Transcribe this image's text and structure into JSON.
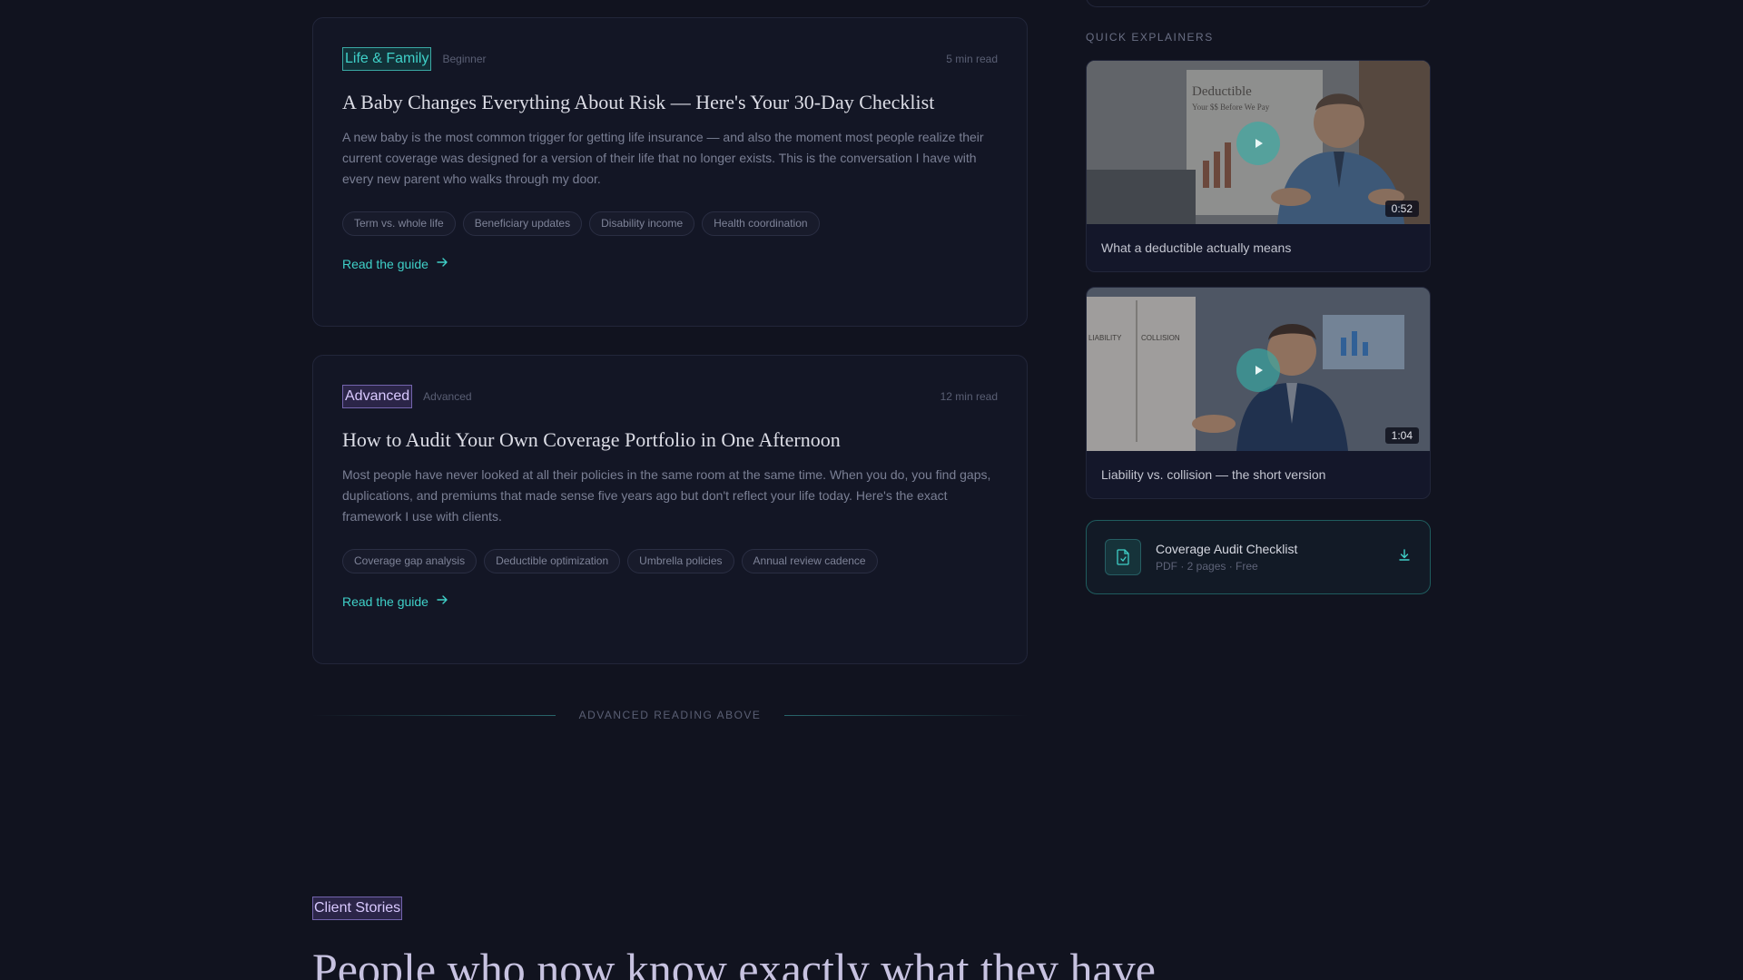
{
  "articles": [
    {
      "category": "Life & Family",
      "level": "Beginner",
      "read_time": "5 min read",
      "title": "A Baby Changes Everything About Risk — Here's Your 30-Day Checklist",
      "description": "A new baby is the most common trigger for getting life insurance — and also the moment most people realize their current coverage was designed for a version of their life that no longer exists. This is the conversation I have with every new parent who walks through my door.",
      "chips": [
        "Term vs. whole life",
        "Beneficiary updates",
        "Disability income",
        "Health coordination"
      ],
      "link": "Read the guide"
    },
    {
      "category": "Advanced",
      "level": "Advanced",
      "read_time": "12 min read",
      "title": "How to Audit Your Own Coverage Portfolio in One Afternoon",
      "description": "Most people have never looked at all their policies in the same room at the same time. When you do, you find gaps, duplications, and premiums that made sense five years ago but don't reflect your life today. Here's the exact framework I use with clients.",
      "chips": [
        "Coverage gap analysis",
        "Deductible optimization",
        "Umbrella policies",
        "Annual review cadence"
      ],
      "link": "Read the guide"
    }
  ],
  "divider_text": "ADVANCED READING ABOVE",
  "client_stories": {
    "tag": "Client Stories",
    "heading": "People who now know exactly what they have"
  },
  "sidebar": {
    "label": "QUICK EXPLAINERS",
    "videos": [
      {
        "title": "What a deductible actually means",
        "duration": "0:52",
        "board_title": "Deductible",
        "board_sub": "Your $$ Before We Pay"
      },
      {
        "title": "Liability vs. collision — the short version",
        "duration": "1:04",
        "board_col1": "LIABILITY",
        "board_col2": "COLLISION"
      }
    ],
    "download": {
      "title": "Coverage Audit Checklist",
      "meta": "PDF · 2 pages · Free"
    }
  },
  "colors": {
    "accent": "#3fd0c8",
    "violet": "#d9c9ff",
    "background": "#11131f"
  }
}
